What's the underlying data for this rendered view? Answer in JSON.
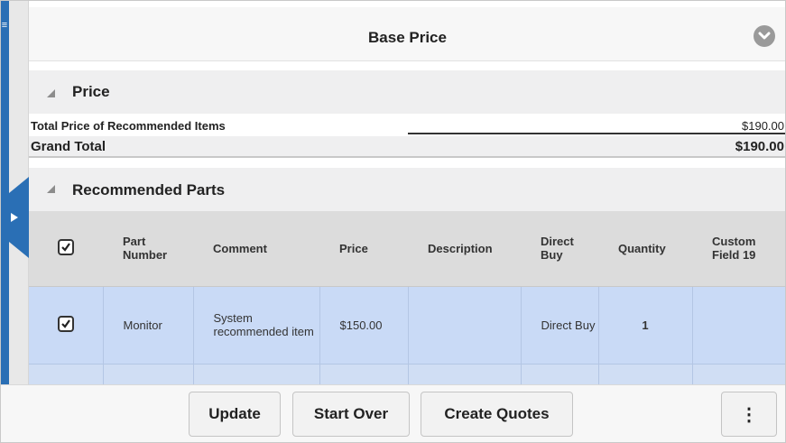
{
  "header": {
    "title": "Base Price"
  },
  "price_section": {
    "title": "Price",
    "total_label": "Total Price of Recommended Items",
    "total_value": "$190.00",
    "grand_label": "Grand Total",
    "grand_value": "$190.00"
  },
  "parts_section": {
    "title": "Recommended Parts",
    "columns": [
      "Part Number",
      "Comment",
      "Price",
      "Description",
      "Direct Buy",
      "Quantity",
      "Custom Field 19"
    ],
    "select_all_checked": true,
    "rows": [
      {
        "checked": true,
        "part_number": "Monitor",
        "comment": "System recommended item",
        "price": "$150.00",
        "description": "",
        "direct_buy": "Direct Buy",
        "quantity": "1",
        "custom_field_19": ""
      }
    ]
  },
  "footer": {
    "update_label": "Update",
    "start_over_label": "Start Over",
    "create_quotes_label": "Create Quotes",
    "more_label": "⋮"
  },
  "icons": {
    "header_toggle": "chevron-down-icon",
    "section_toggle": "collapse-triangle-icon",
    "side_tab": "play-arrow-icon",
    "menu": "hamburger-menu-icon"
  },
  "colors": {
    "accent": "#2a6fb5",
    "selected_row": "#c9daf6",
    "header_bg": "#dcdcdc"
  }
}
